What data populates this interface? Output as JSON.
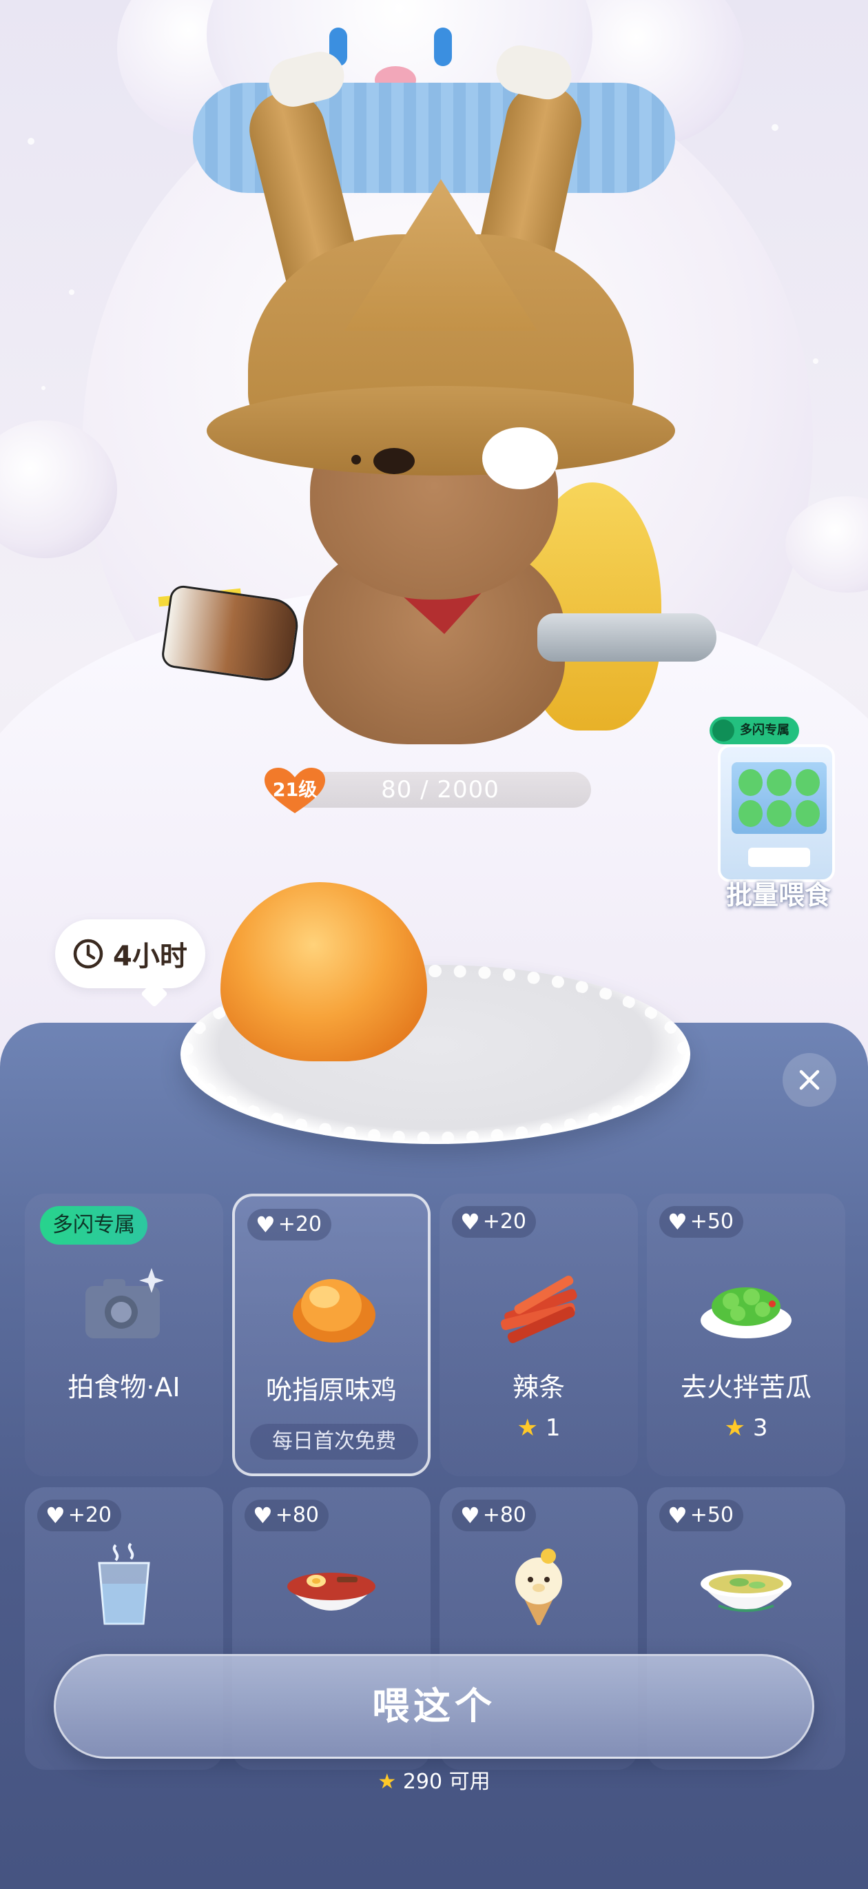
{
  "level": {
    "badge": "21级",
    "progress_text": "80 / 2000",
    "progress": 0.04
  },
  "batch_feed": {
    "badge": "多闪专属",
    "label": "批量喂食"
  },
  "timer": {
    "text": "4小时"
  },
  "panel": {
    "items": [
      {
        "exclusive_badge": "多闪专属",
        "name": "拍食物·AI",
        "icon": "camera-icon"
      },
      {
        "heart": "+20",
        "name": "吮指原味鸡",
        "sub": "每日首次免费",
        "selected": true,
        "icon": "fried-chicken"
      },
      {
        "heart": "+20",
        "name": "辣条",
        "cost": "1",
        "icon": "spicy-strips"
      },
      {
        "heart": "+50",
        "name": "去火拌苦瓜",
        "cost": "3",
        "icon": "bitter-melon"
      },
      {
        "heart": "+20",
        "icon": "water-glass"
      },
      {
        "heart": "+80",
        "icon": "noodle-bowl"
      },
      {
        "heart": "+80",
        "icon": "ice-cream"
      },
      {
        "heart": "+50",
        "icon": "soup-bowl"
      }
    ],
    "feed_button": "喂这个",
    "balance": "290 可用"
  },
  "colors": {
    "accent_green": "#28d38d",
    "panel_top": "#6f84b5",
    "panel_bottom": "#465481",
    "star": "#ffc928",
    "heart_orange": "#f27a2a"
  }
}
